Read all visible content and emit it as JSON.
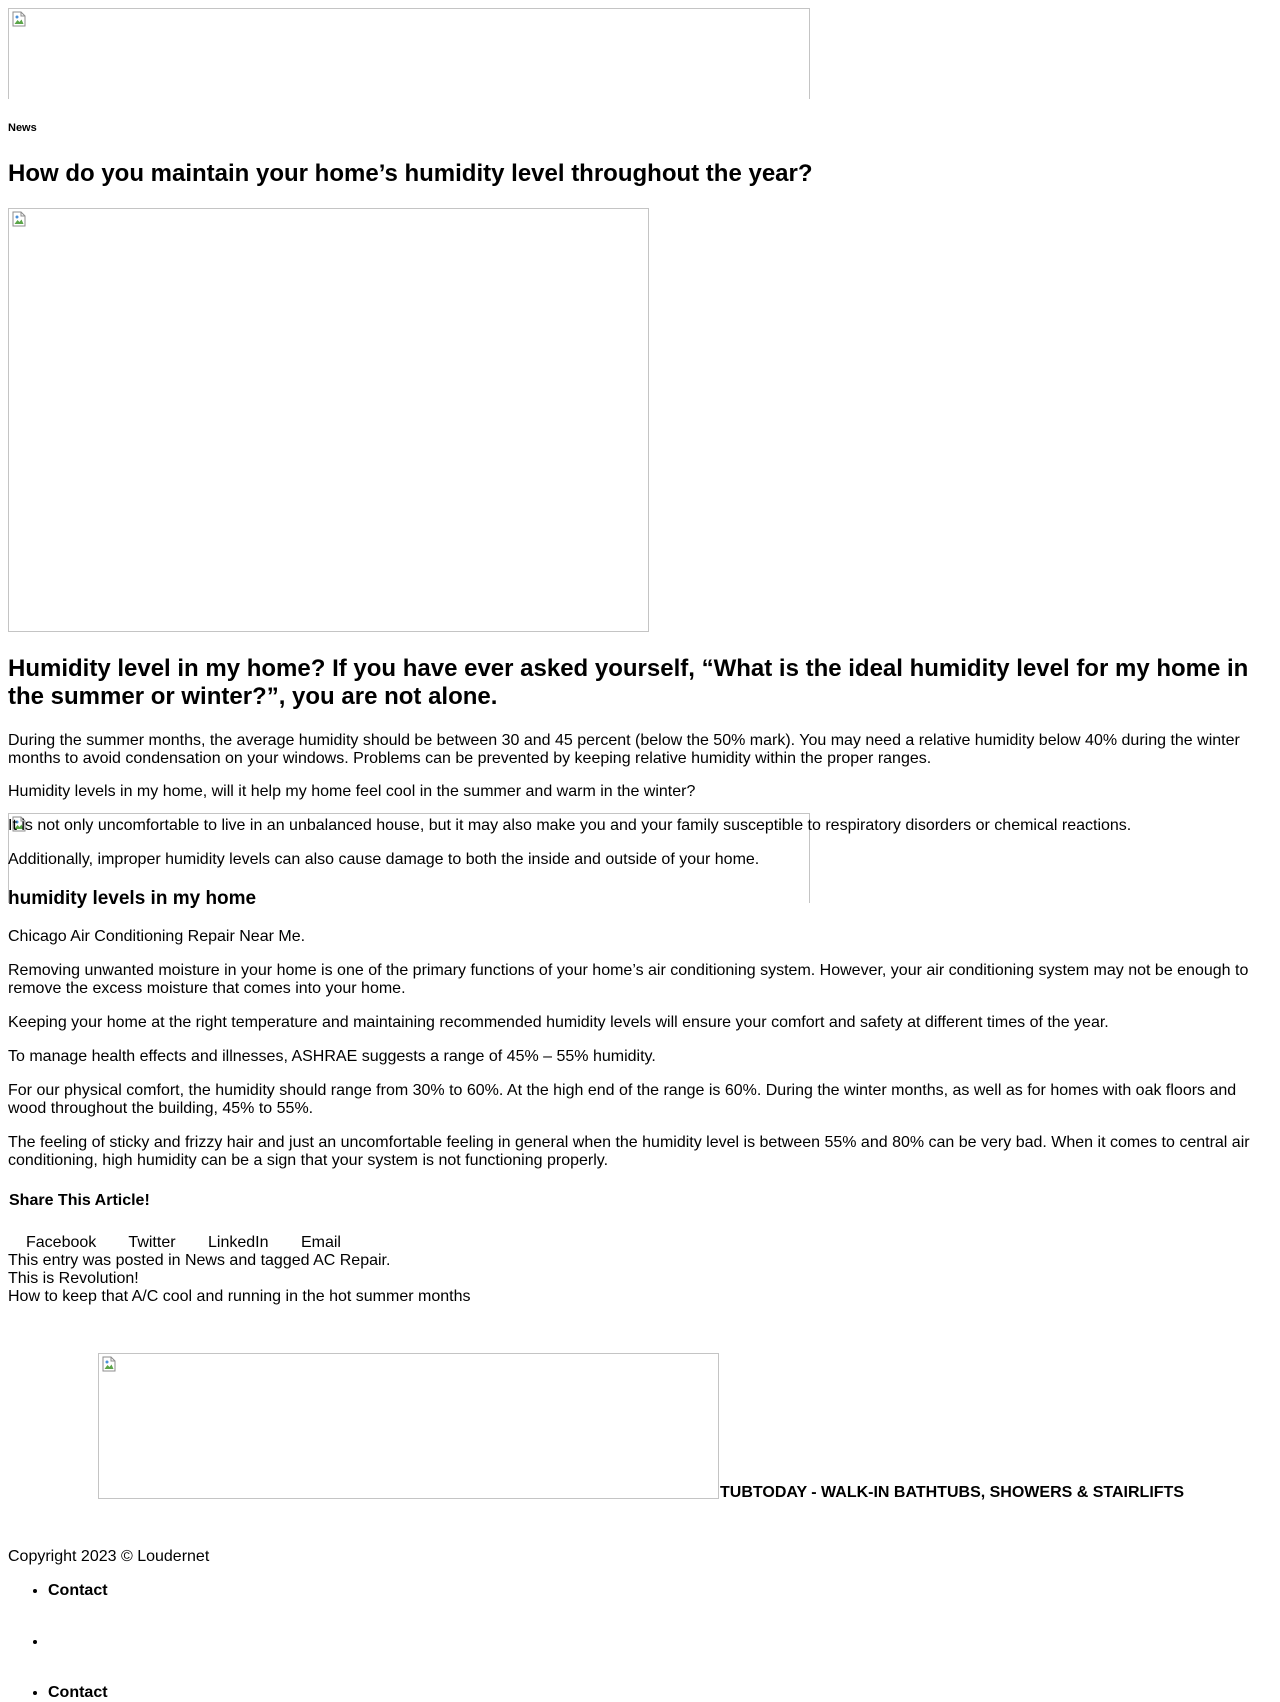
{
  "header": {
    "category": "News"
  },
  "article": {
    "title": "How do you maintain your home’s humidity level throughout the year?",
    "subhead": "Humidity level in my home? If you have ever asked yourself, “What is the ideal humidity level for my home in the summer or winter?”, you are not alone.",
    "paragraphs_top": [
      "During the summer months, the average humidity should be between 30 and 45 percent (below the 50% mark). You may need a relative humidity below 40% during the winter months to avoid condensation on your windows. Problems can be prevented by keeping relative humidity within the proper ranges.",
      "Humidity levels in my home, will it help my home feel cool in the summer and warm in the winter?",
      "It is not only uncomfortable to live in an unbalanced house, but it may also make you and your family susceptible to respiratory disorders or chemical reactions.",
      "Additionally, improper humidity levels can also cause damage to both the inside and outside of your home."
    ],
    "section_heading": "humidity levels in my home",
    "paragraphs_bottom": [
      "Chicago Air Conditioning Repair Near Me.",
      "Removing unwanted moisture in your home is one of the primary functions of your home’s air conditioning system. However, your air conditioning system may not be enough to remove the excess moisture that comes into your home.",
      "Keeping your home at the right temperature and maintaining recommended humidity levels will ensure your comfort and safety at different times of the year.",
      "To manage health effects and illnesses, ASHRAE suggests a range of 45% – 55% humidity.",
      "For our physical comfort, the humidity should range from 30% to 60%. At the high end of the range is 60%. During the winter months, as well as for homes with oak floors and wood throughout the building, 45% to 55%.",
      "The feeling of sticky and frizzy hair and just an uncomfortable feeling in general when the humidity level is between 55% and 80% can be very bad. When it comes to central air conditioning, high humidity can be a sign that your system is not functioning properly."
    ]
  },
  "share": {
    "title": "Share This Article!",
    "links": [
      "Facebook",
      "Twitter",
      "LinkedIn",
      "Email"
    ]
  },
  "meta": {
    "posted_prefix": "This entry was posted in ",
    "category_link": "News",
    "tagged_middle": " and tagged ",
    "tag_link": "AC Repair",
    "posted_suffix": ".",
    "prev_post": "This is Revolution!",
    "next_post": "How to keep that A/C cool and running in the hot summer months"
  },
  "footer": {
    "brand": "TUBTODAY - WALK-IN BATHTUBS, SHOWERS & STAIRLIFTS",
    "copyright": "Copyright 2023 © Loudernet",
    "menu": [
      "Contact",
      "",
      "Contact"
    ]
  },
  "icons": {
    "broken_image": "broken-image-icon"
  }
}
